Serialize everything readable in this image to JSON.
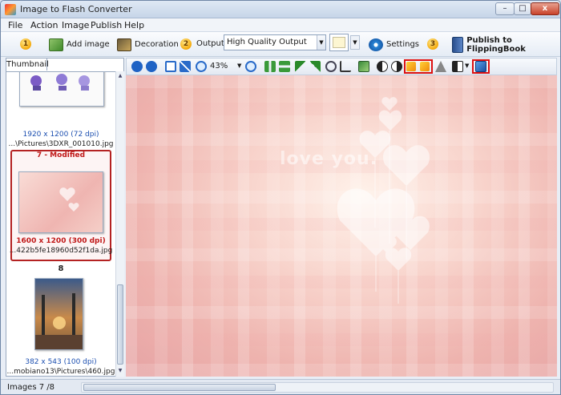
{
  "window": {
    "title": "Image to Flash Converter",
    "min": "–",
    "max": "□",
    "close": "x"
  },
  "menu": [
    "File",
    "Action",
    "Image",
    "Publish",
    "Help"
  ],
  "toolbar": {
    "step1": "1",
    "add_image": "Add image",
    "decoration": "Decoration",
    "step2": "2",
    "output_label": "Output:",
    "output_value": "High Quality Output",
    "settings": "Settings",
    "step3": "3",
    "publish": "Publish to FlippingBook"
  },
  "sidebar": {
    "tab": "Thumbnail",
    "items": [
      {
        "info": "1920 x 1200 (72 dpi)",
        "path": "...\\Pictures\\3DXR_001010.jpg"
      },
      {
        "title": "7 - Modified",
        "info": "1600 x 1200 (300 dpi)",
        "path": "...422b5fe18960d52f1da.jpg"
      },
      {
        "number": "8",
        "info": "382 x 543 (100 dpi)",
        "path": "...mobiano13\\Pictures\\460.jpg"
      }
    ]
  },
  "viewer": {
    "zoom": "43%",
    "caption": "love you."
  },
  "status": {
    "text": "Images 7 /8"
  },
  "colors": {
    "selection": "#b42222",
    "highlight": "#dd1111",
    "swatch": "#fdf6d2"
  }
}
